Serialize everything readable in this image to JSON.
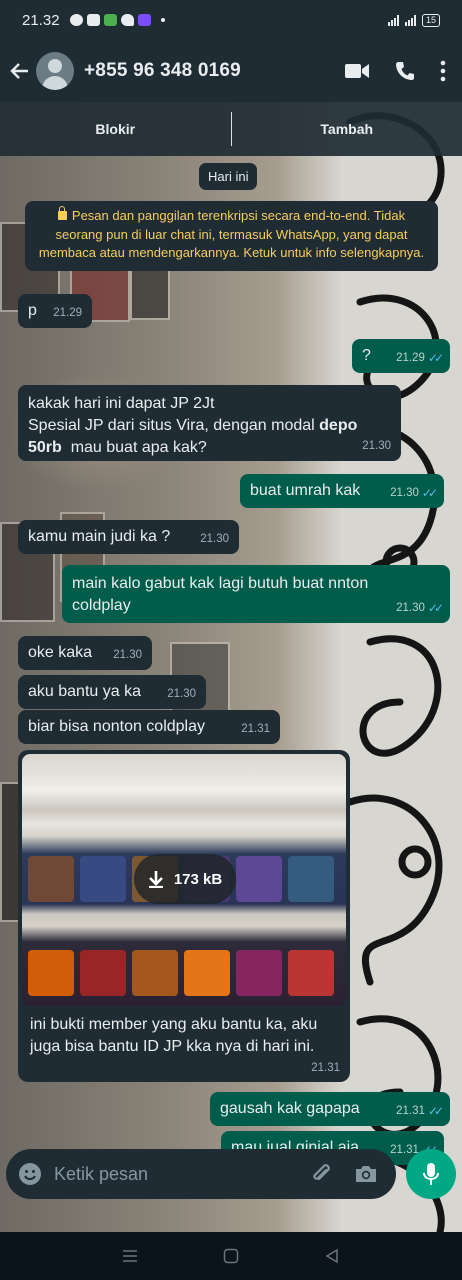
{
  "status_bar": {
    "time": "21.32",
    "battery": "15"
  },
  "header": {
    "contact": "+855 96 348 0169"
  },
  "action_bar": {
    "block_label": "Blokir",
    "add_label": "Tambah"
  },
  "chat": {
    "date_chip": "Hari ini",
    "encryption_notice": "Pesan dan panggilan terenkripsi secara end-to-end. Tidak seorang pun di luar chat ini, termasuk WhatsApp, yang dapat membaca atau mendengarkannya. Ketuk untuk info selengkapnya.",
    "messages": [
      {
        "dir": "in",
        "text": "p",
        "time": "21.29"
      },
      {
        "dir": "out",
        "text": "?",
        "time": "21.29"
      },
      {
        "dir": "in",
        "text_pre": "kakak hari ini dapat JP 2Jt\nSpesial JP dari situs Vira, dengan modal ",
        "text_bold": "depo 50rb",
        "text_post": "  mau buat apa kak?",
        "time": "21.30"
      },
      {
        "dir": "out",
        "text": "buat umrah kak",
        "time": "21.30"
      },
      {
        "dir": "in",
        "text": "kamu main judi ka ?",
        "time": "21.30"
      },
      {
        "dir": "out",
        "text": "main kalo gabut kak lagi butuh buat nnton coldplay",
        "time": "21.30"
      },
      {
        "dir": "in",
        "text": "oke kaka",
        "time": "21.30"
      },
      {
        "dir": "in",
        "text": "aku bantu ya ka",
        "time": "21.30"
      },
      {
        "dir": "in",
        "text": "biar bisa nonton coldplay",
        "time": "21.31"
      },
      {
        "dir": "in",
        "type": "image",
        "size": "173 kB",
        "caption": "ini bukti member yang aku bantu ka, aku juga bisa bantu ID JP kka nya di hari ini.",
        "time": "21.31"
      },
      {
        "dir": "out",
        "text": "gausah kak gapapa",
        "time": "21.31"
      },
      {
        "dir": "out",
        "text": "mau jual ginjal aja",
        "time": "21.31"
      }
    ]
  },
  "composer": {
    "placeholder": "Ketik pesan"
  },
  "colors": {
    "incoming": "#1f2c34",
    "outgoing": "#005c4b",
    "accent": "#00a884",
    "read_ticks": "#53bdeb",
    "notice_text": "#f7cd5b"
  },
  "icons": [
    "back-arrow-icon",
    "video-call-icon",
    "phone-icon",
    "more-options-icon",
    "lock-icon",
    "download-icon",
    "emoji-icon",
    "attach-icon",
    "camera-icon",
    "mic-icon",
    "nav-menu-icon",
    "nav-home-icon",
    "nav-back-icon"
  ]
}
